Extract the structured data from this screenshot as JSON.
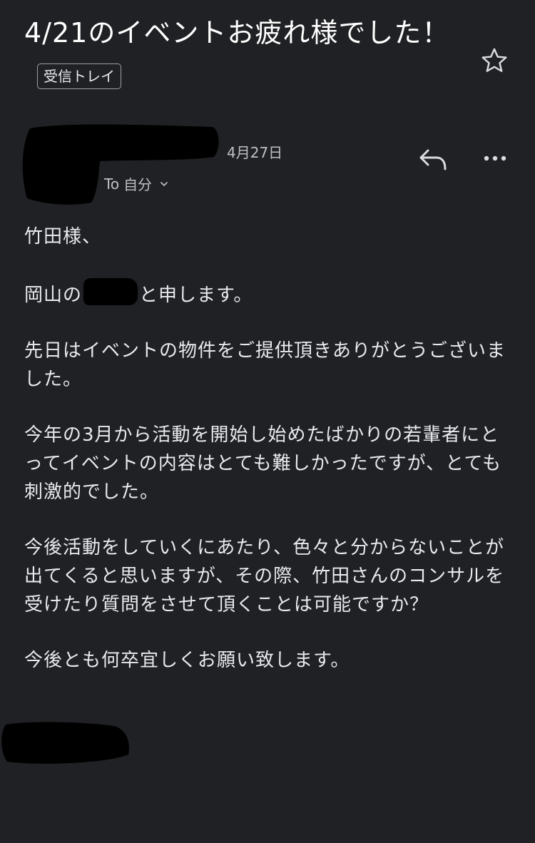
{
  "email": {
    "subject": "4/21のイベントお疲れ様でした！",
    "label": "受信トレイ",
    "date": "4月27日",
    "to_label": "To",
    "to_value": "自分",
    "body": {
      "greeting": "竹田様、",
      "intro_prefix": "岡山の",
      "intro_suffix": "と申します。",
      "para1": "先日はイベントの物件をご提供頂きありがとうございました。",
      "para2": "今年の3月から活動を開始し始めたばかりの若輩者にとってイベントの内容はとても難しかったですが、とても刺激的でした。",
      "para3": "今後活動をしていくにあたり、色々と分からないことが出てくると思いますが、その際、竹田さんのコンサルを受けたり質問をさせて頂くことは可能ですか？",
      "closing": "今後とも何卒宜しくお願い致します。"
    }
  },
  "icons": {
    "star": "star-icon",
    "reply": "reply-icon",
    "more": "more-horizontal-icon",
    "chevron": "chevron-down-icon"
  },
  "colors": {
    "background": "#202124",
    "text": "#e8eaed",
    "secondary_text": "#bdc1c6",
    "redaction": "#000000"
  }
}
